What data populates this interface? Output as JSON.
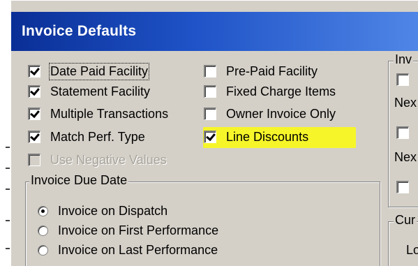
{
  "window": {
    "title": "Invoice Defaults"
  },
  "left_checkboxes": [
    {
      "label": "Date Paid Facility",
      "checked": true,
      "disabled": false,
      "focused": true
    },
    {
      "label": "Statement Facility",
      "checked": true,
      "disabled": false,
      "focused": false
    },
    {
      "label": "Multiple Transactions",
      "checked": true,
      "disabled": false,
      "focused": false
    },
    {
      "label": "Match Perf. Type",
      "checked": true,
      "disabled": false,
      "focused": false
    },
    {
      "label": "Use Negative Values",
      "checked": false,
      "disabled": true,
      "focused": false
    }
  ],
  "middle_checkboxes": [
    {
      "label": "Pre-Paid Facility",
      "checked": false
    },
    {
      "label": "Fixed Charge Items",
      "checked": false
    },
    {
      "label": "Owner Invoice Only",
      "checked": false
    },
    {
      "label": "Line Discounts",
      "checked": true,
      "highlighted": true,
      "highlight_color": "#f6f52a"
    }
  ],
  "invoice_due_date": {
    "group_label": "Invoice Due Date",
    "options": [
      {
        "label": "Invoice on Dispatch",
        "selected": true
      },
      {
        "label": "Invoice on First Performance",
        "selected": false
      },
      {
        "label": "Invoice on Last Performance",
        "selected": false
      }
    ]
  },
  "right_panel": {
    "group_label": "Inv",
    "next_label_1": "Nex",
    "next_label_2": "Nex",
    "checkboxes": [
      {
        "checked": false
      },
      {
        "checked": false
      },
      {
        "checked": false
      }
    ],
    "group2_label": "Cur",
    "group2_text": "Lo"
  },
  "colors": {
    "title_bar_start": "#0a2f96",
    "title_bar_end": "#4f86e6",
    "window_face": "#d4d0c8",
    "highlight": "#f6f52a"
  }
}
